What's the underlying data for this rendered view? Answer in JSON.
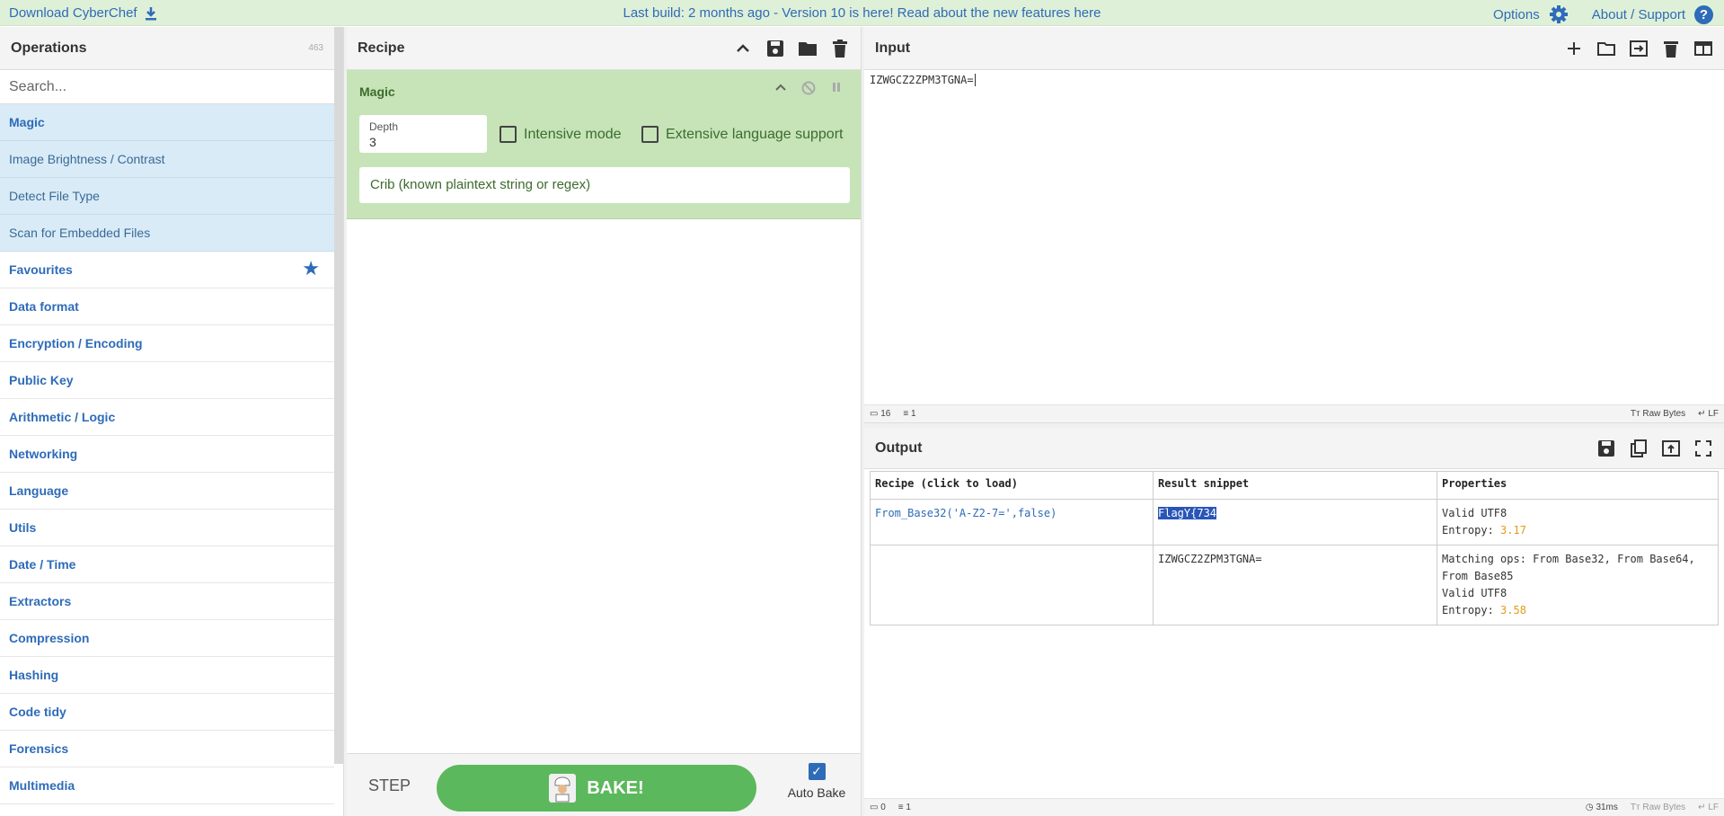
{
  "banner": {
    "download": "Download CyberChef",
    "center": "Last build: 2 months ago - Version 10 is here! Read about the new features here",
    "options": "Options",
    "about": "About / Support"
  },
  "operations": {
    "title": "Operations",
    "count": "463",
    "search_placeholder": "Search...",
    "results": [
      "Magic",
      "Image Brightness / Contrast",
      "Detect File Type",
      "Scan for Embedded Files"
    ],
    "categories": [
      "Favourites",
      "Data format",
      "Encryption / Encoding",
      "Public Key",
      "Arithmetic / Logic",
      "Networking",
      "Language",
      "Utils",
      "Date / Time",
      "Extractors",
      "Compression",
      "Hashing",
      "Code tidy",
      "Forensics",
      "Multimedia"
    ]
  },
  "recipe": {
    "title": "Recipe",
    "op_title": "Magic",
    "depth_label": "Depth",
    "depth_value": "3",
    "intensive_label": "Intensive mode",
    "extensive_label": "Extensive language support",
    "crib_placeholder": "Crib (known plaintext string or regex)",
    "step_label": "STEP",
    "bake_label": "BAKE!",
    "autobake_label": "Auto Bake"
  },
  "input": {
    "title": "Input",
    "text": "IZWGCZ2ZPM3TGNA=",
    "status_chars": "16",
    "status_lines": "1",
    "status_format": "Raw Bytes",
    "status_eol": "LF"
  },
  "output": {
    "title": "Output",
    "table": {
      "headers": [
        "Recipe (click to load)",
        "Result snippet",
        "Properties"
      ],
      "row1": {
        "recipe": "From_Base32('A-Z2-7=',false)",
        "snippet": "FlagY{734",
        "prop1": "Valid UTF8",
        "entropy_label": "Entropy:",
        "entropy": "3.17"
      },
      "row2": {
        "recipe": "",
        "snippet": "IZWGCZ2ZPM3TGNA=",
        "prop1": "Matching ops: From Base32, From Base64, From Base85",
        "prop2": "Valid UTF8",
        "entropy_label": "Entropy:",
        "entropy": "3.58"
      }
    },
    "status_chars": "0",
    "status_lines": "1",
    "status_time": "31ms",
    "status_format": "Raw Bytes",
    "status_eol": "LF"
  }
}
